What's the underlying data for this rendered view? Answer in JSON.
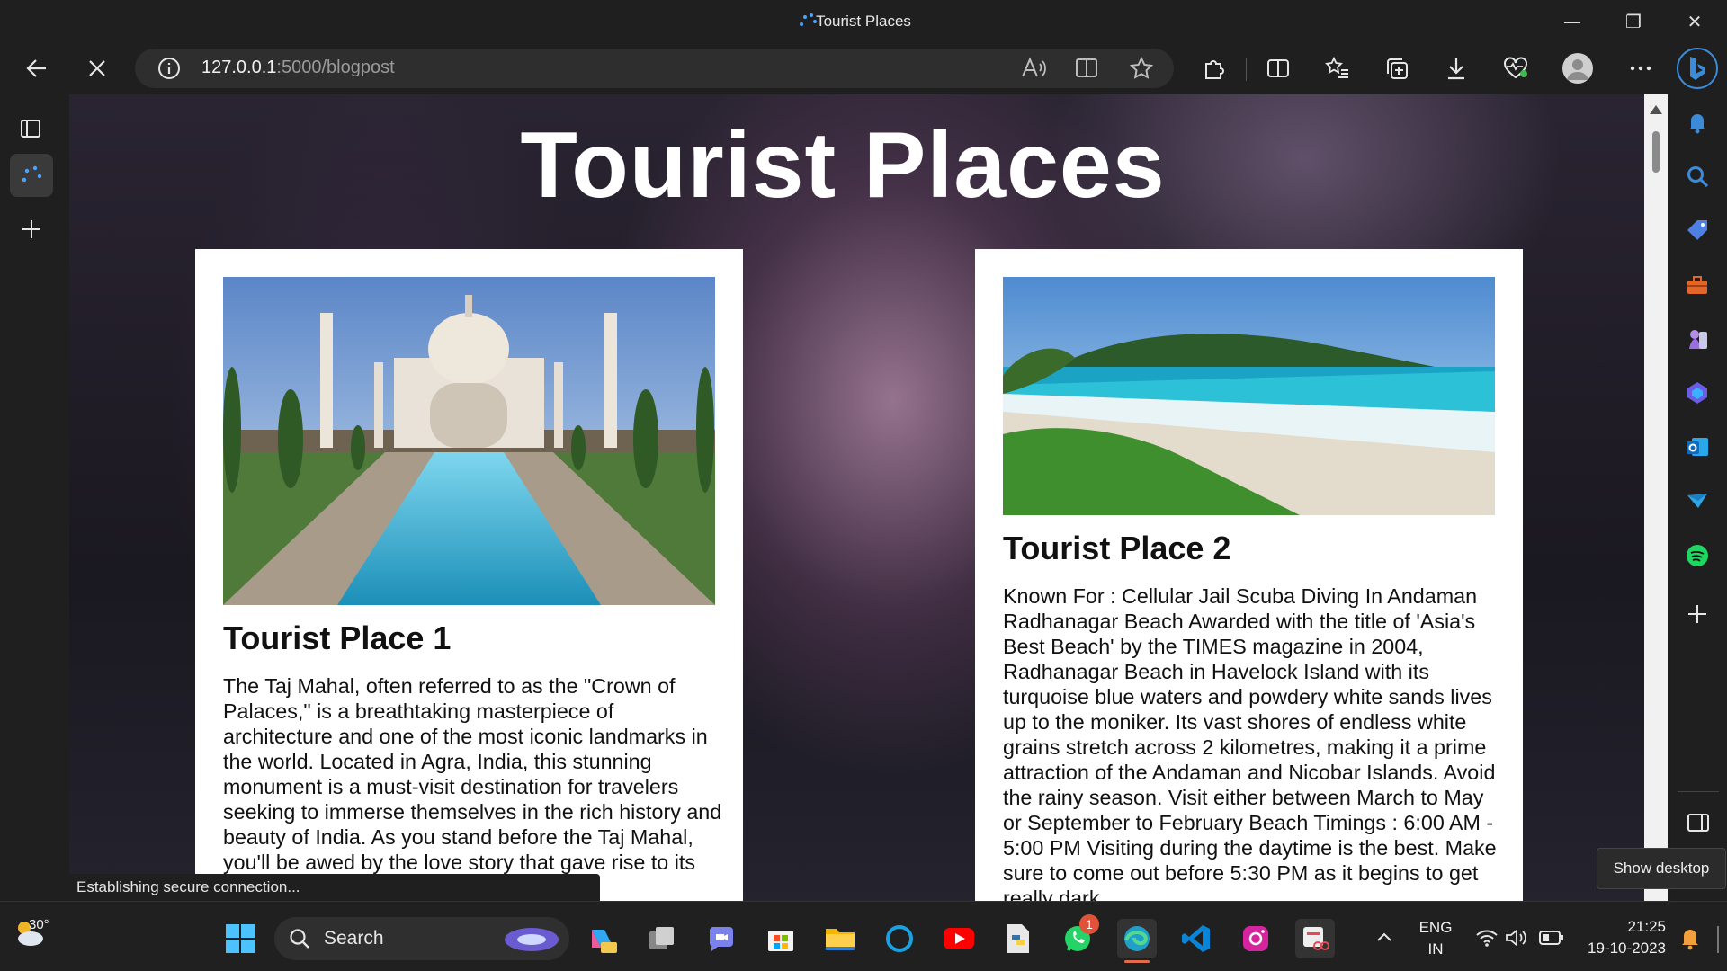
{
  "window": {
    "title": "Tourist Places",
    "minimize": "—",
    "maximize": "❐",
    "close": "✕"
  },
  "toolbar": {
    "url_host": "127.0.0.1",
    "url_path": ":5000/blogpost"
  },
  "page": {
    "heading": "Tourist Places",
    "cards": [
      {
        "title": "Tourist Place 1",
        "image_alt": "Taj Mahal with reflecting pool",
        "text": "The Taj Mahal, often referred to as the \"Crown of Palaces,\" is a breathtaking masterpiece of architecture and one of the most iconic landmarks in the world. Located in Agra, India, this stunning monument is a must-visit destination for travelers seeking to immerse themselves in the rich history and beauty of India. As you stand before the Taj Mahal, you'll be awed by the love story that gave rise to its creation. Built by the Mughal Emperor"
      },
      {
        "title": "Tourist Place 2",
        "image_alt": "Radhanagar Beach with turquoise water",
        "text": "Known For : Cellular Jail Scuba Diving In Andaman Radhanagar Beach Awarded with the title of 'Asia's Best Beach' by the TIMES magazine in 2004, Radhanagar Beach in Havelock Island with its turquoise blue waters and powdery white sands lives up to the moniker. Its vast shores of endless white grains stretch across 2 kilometres, making it a prime attraction of the Andaman and Nicobar Islands. Avoid the rainy season. Visit either between March to May or September to February Beach Timings : 6:00 AM - 5:00 PM Visiting during the daytime is the best. Make sure to come out before 5:30 PM as it begins to get really dark"
      }
    ]
  },
  "status_bubble": "Establishing secure connection...",
  "tooltip": "Show desktop",
  "taskbar": {
    "weather_temp": "30°",
    "search_label": "Search",
    "whatsapp_badge": "1",
    "language_line1": "ENG",
    "language_line2": "IN",
    "time": "21:25",
    "date": "19-10-2023",
    "apps": [
      "windows-start",
      "copilot-pre",
      "task-view",
      "teams",
      "microsoft-store",
      "file-explorer",
      "cortana",
      "youtube",
      "python",
      "whatsapp",
      "edge",
      "vscode",
      "instagram",
      "snipping-tool"
    ]
  },
  "colors": {
    "accent": "#3b8bd8",
    "card_bg": "#ffffff",
    "chrome_bg": "#1f1f1f"
  }
}
